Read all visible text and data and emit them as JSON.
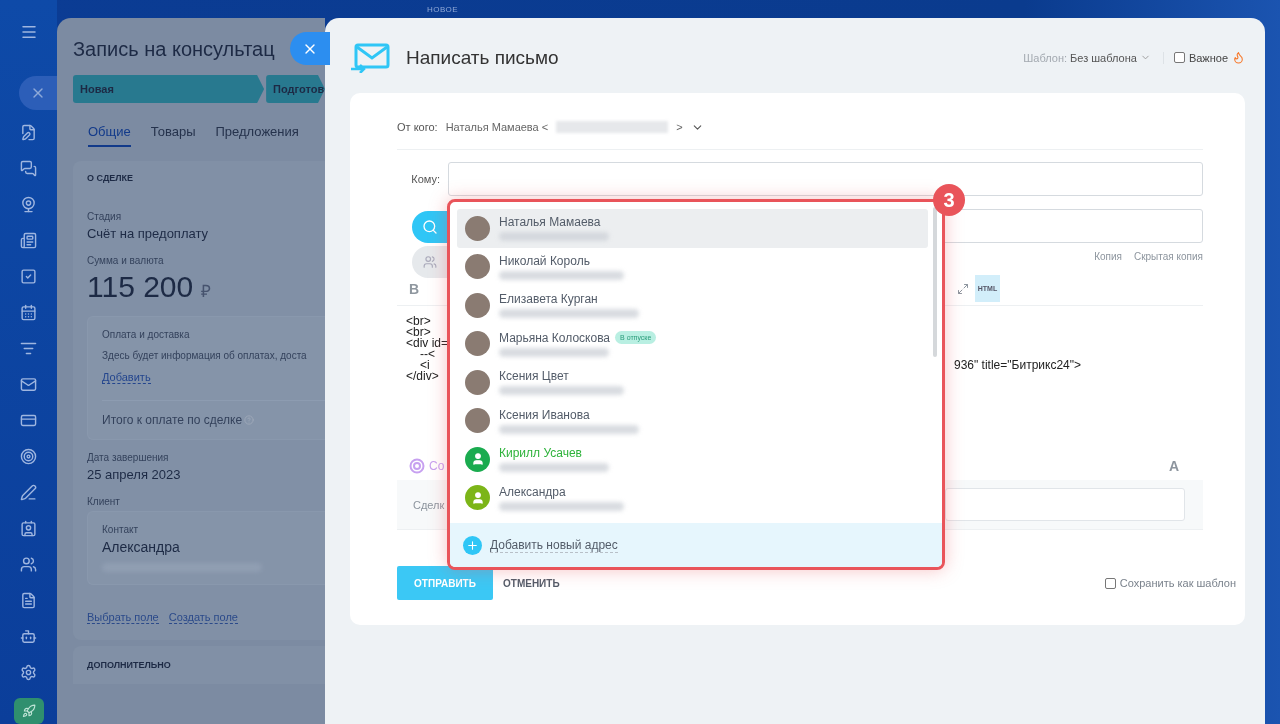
{
  "top_label": "НОВОЕ",
  "deal": {
    "title": "Запись на консультац",
    "stages": [
      {
        "label": "Новая"
      },
      {
        "label": "Подготов"
      }
    ],
    "tabs": [
      {
        "label": "Общие",
        "selected": true
      },
      {
        "label": "Товары",
        "selected": false
      },
      {
        "label": "Предложения",
        "selected": false
      }
    ],
    "section_title": "О СДЕЛКЕ",
    "stage_label": "Стадия",
    "stage_value": "Счёт на предоплату",
    "amount_label": "Сумма и валюта",
    "amount": "115 200",
    "currency": "₽",
    "payment": {
      "title": "Оплата и доставка",
      "text": "Здесь будет информация об оплатах, доста",
      "add_link": "Добавить",
      "total_label": "Итого к оплате по сделке"
    },
    "close_date_label": "Дата завершения",
    "close_date": "25 апреля 2023",
    "client_label": "Клиент",
    "contact_label": "Контакт",
    "contact_name": "Александра",
    "links": [
      "Выбрать поле",
      "Создать поле"
    ],
    "extra_section_title": "ДОПОЛНИТЕЛЬНО"
  },
  "email": {
    "title": "Написать письмо",
    "template_label": "Шаблон:",
    "template_value": "Без шаблона",
    "important": {
      "label": "Важное",
      "checked": false
    },
    "from_label": "От кого:",
    "from_name": "Наталья Мамаева <",
    "from_close": ">",
    "to_label": "Кому:",
    "copy_links": [
      "Копия",
      "Скрытая копия"
    ],
    "bold_button": "B",
    "format_button": "HTML",
    "editor_lines": [
      {
        "text": "<br>"
      },
      {
        "text": "<br>"
      },
      {
        "text": "<div id=",
        "children": [
          {
            "text": "--<"
          },
          {
            "text": "<i",
            "tail": "936\" title=\"Битрикс24\">"
          }
        ]
      },
      {
        "text": "</div>"
      }
    ],
    "copilot": "Co",
    "font_button": "A",
    "deal_field_label": "Сделк",
    "send": "ОТПРАВИТЬ",
    "cancel": "ОТМЕНИТЬ",
    "save_template": {
      "label": "Сохранить как шаблон",
      "checked": false
    }
  },
  "dropdown": {
    "badge": "3",
    "add_label": "Добавить новый адрес",
    "contacts": [
      {
        "name": "Наталья Мамаева",
        "kind": "photo",
        "selected": true,
        "highlighted": false
      },
      {
        "name": "Николай Король",
        "kind": "photo",
        "selected": false,
        "highlighted": false
      },
      {
        "name": "Елизавета Курган",
        "kind": "photo",
        "selected": false,
        "highlighted": false
      },
      {
        "name": "Марьяна Колоскова",
        "kind": "photo",
        "selected": false,
        "highlighted": false,
        "badge": "В отпуске"
      },
      {
        "name": "Ксения Цвет",
        "kind": "photo",
        "selected": false,
        "highlighted": false
      },
      {
        "name": "Ксения Иванова",
        "kind": "photo",
        "selected": false,
        "highlighted": false
      },
      {
        "name": "Кирилл Усачев",
        "kind": "placeholder",
        "color": "#1aab4f",
        "selected": false,
        "highlighted": true
      },
      {
        "name": "Александра",
        "kind": "placeholder",
        "color": "#7cb518",
        "selected": false,
        "highlighted": false
      }
    ]
  }
}
